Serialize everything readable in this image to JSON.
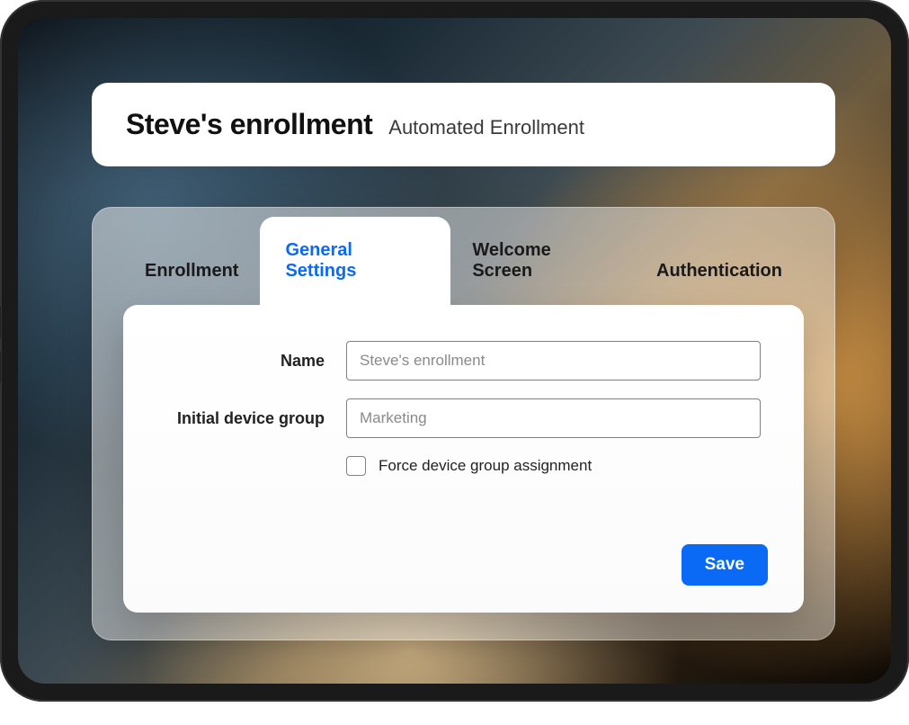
{
  "header": {
    "title": "Steve's enrollment",
    "subtitle": "Automated Enrollment"
  },
  "tabs": [
    {
      "label": "Enrollment",
      "active": false
    },
    {
      "label": "General Settings",
      "active": true
    },
    {
      "label": "Welcome Screen",
      "active": false
    },
    {
      "label": "Authentication",
      "active": false
    }
  ],
  "form": {
    "name_label": "Name",
    "name_placeholder": "Steve's enrollment",
    "group_label": "Initial device group",
    "group_placeholder": "Marketing",
    "force_checkbox_label": "Force device group assignment",
    "force_checked": false,
    "save_button": "Save"
  }
}
